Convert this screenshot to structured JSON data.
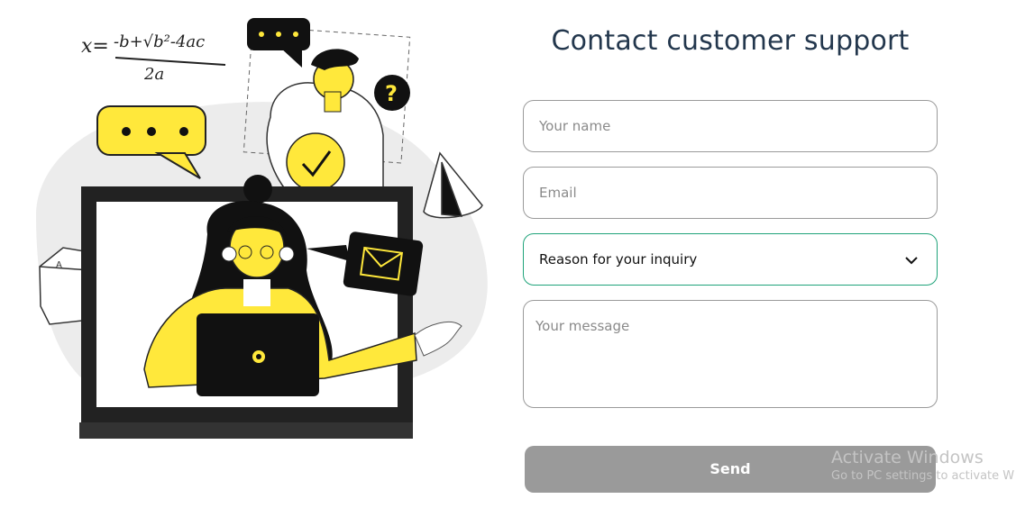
{
  "form": {
    "title": "Contact customer support",
    "name_placeholder": "Your name",
    "email_placeholder": "Email",
    "reason_selected": "Reason for your inquiry",
    "message_placeholder": "Your message",
    "send_label": "Send"
  },
  "illustration": {
    "formula": "x=-b±√b²-4ac / 2a"
  },
  "watermark": {
    "line1": "Activate Windows",
    "line2": "Go to PC settings to activate W"
  },
  "colors": {
    "accent_yellow": "#ffe83b",
    "title_color": "#23374d",
    "focus_border": "#1fa37a",
    "send_button_bg": "#9a9a9a"
  },
  "icons": [
    "chevron-down-icon",
    "gear-icon",
    "envelope-icon",
    "checkmark-icon",
    "question-icon"
  ]
}
